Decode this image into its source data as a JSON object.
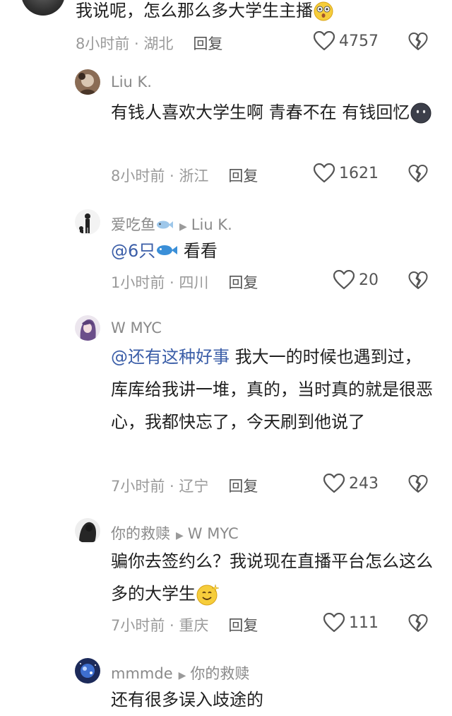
{
  "comments": [
    {
      "text": "我说呢，怎么那么多大学生主播",
      "time_loc": "8小时前 · 湖北",
      "reply_label": "回复",
      "likes": "4757"
    },
    {
      "user": "Liu K.",
      "text": "有钱人喜欢大学生啊 青春不在 有钱回忆",
      "time_loc": "8小时前 · 浙江",
      "reply_label": "回复",
      "likes": "1621"
    },
    {
      "user": "爱吃鱼",
      "reply_to": "Liu K.",
      "mention": "@6只",
      "text": "看看",
      "time_loc": "1小时前 · 四川",
      "reply_label": "回复",
      "likes": "20"
    },
    {
      "user": "W MYC",
      "mention": "@还有这种好事",
      "text": " 我大一的时候也遇到过，库库给我讲一堆，真的，当时真的就是很恶心，我都快忘了，今天刷到他说了",
      "time_loc": "7小时前 · 辽宁",
      "reply_label": "回复",
      "likes": "243"
    },
    {
      "user": "你的救赎",
      "reply_to": "W MYC",
      "text": "骗你去签约么？我说现在直播平台怎么这么多的大学生",
      "time_loc": "7小时前 · 重庆",
      "reply_label": "回复",
      "likes": "111"
    },
    {
      "user": "mmmde",
      "reply_to": "你的救赎",
      "text": "还有很多误入歧途的"
    }
  ],
  "icons": {
    "like": "heart-outline-icon",
    "dislike": "broken-heart-icon",
    "reply_arrow": "triangle-right-icon"
  },
  "colors": {
    "mention": "#3b5ea8",
    "meta": "#9a9a9a",
    "username": "#8a8a8a"
  }
}
